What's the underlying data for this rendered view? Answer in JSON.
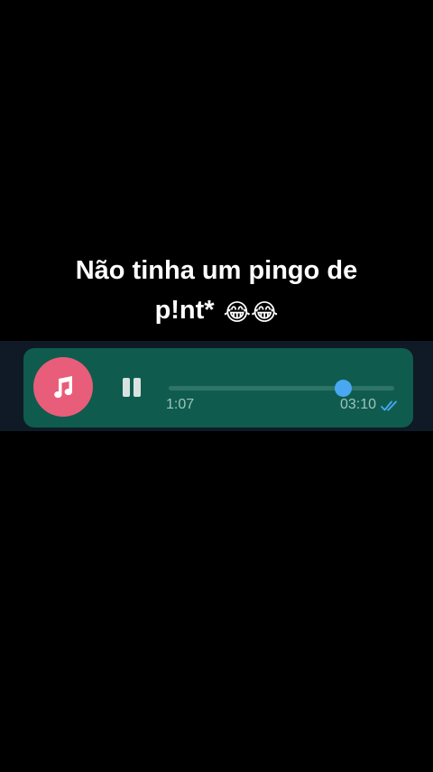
{
  "caption": {
    "line1": "Não tinha um pingo de",
    "line2": "p!nt*",
    "emojis": "😂😂"
  },
  "audio_message": {
    "icon": "music-note-icon",
    "control": "pause-icon",
    "elapsed": "1:07",
    "timestamp": "03:10",
    "progress": 0.77,
    "status": "read-double-check-icon"
  },
  "colors": {
    "background": "#000000",
    "bubble": "#0f5c4e",
    "avatar": "#e85d79",
    "thumb": "#4aa7f2",
    "ticks": "#4aa7f2"
  }
}
